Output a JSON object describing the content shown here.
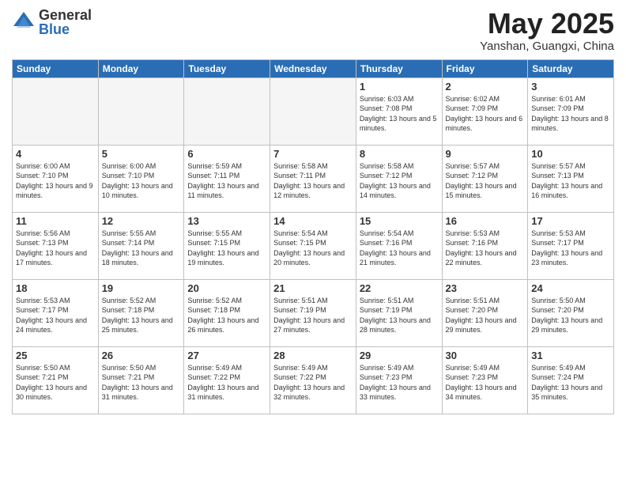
{
  "header": {
    "logo_general": "General",
    "logo_blue": "Blue",
    "month": "May 2025",
    "location": "Yanshan, Guangxi, China"
  },
  "weekdays": [
    "Sunday",
    "Monday",
    "Tuesday",
    "Wednesday",
    "Thursday",
    "Friday",
    "Saturday"
  ],
  "weeks": [
    [
      {
        "day": "",
        "info": ""
      },
      {
        "day": "",
        "info": ""
      },
      {
        "day": "",
        "info": ""
      },
      {
        "day": "",
        "info": ""
      },
      {
        "day": "1",
        "info": "Sunrise: 6:03 AM\nSunset: 7:08 PM\nDaylight: 13 hours\nand 5 minutes."
      },
      {
        "day": "2",
        "info": "Sunrise: 6:02 AM\nSunset: 7:09 PM\nDaylight: 13 hours\nand 6 minutes."
      },
      {
        "day": "3",
        "info": "Sunrise: 6:01 AM\nSunset: 7:09 PM\nDaylight: 13 hours\nand 8 minutes."
      }
    ],
    [
      {
        "day": "4",
        "info": "Sunrise: 6:00 AM\nSunset: 7:10 PM\nDaylight: 13 hours\nand 9 minutes."
      },
      {
        "day": "5",
        "info": "Sunrise: 6:00 AM\nSunset: 7:10 PM\nDaylight: 13 hours\nand 10 minutes."
      },
      {
        "day": "6",
        "info": "Sunrise: 5:59 AM\nSunset: 7:11 PM\nDaylight: 13 hours\nand 11 minutes."
      },
      {
        "day": "7",
        "info": "Sunrise: 5:58 AM\nSunset: 7:11 PM\nDaylight: 13 hours\nand 12 minutes."
      },
      {
        "day": "8",
        "info": "Sunrise: 5:58 AM\nSunset: 7:12 PM\nDaylight: 13 hours\nand 14 minutes."
      },
      {
        "day": "9",
        "info": "Sunrise: 5:57 AM\nSunset: 7:12 PM\nDaylight: 13 hours\nand 15 minutes."
      },
      {
        "day": "10",
        "info": "Sunrise: 5:57 AM\nSunset: 7:13 PM\nDaylight: 13 hours\nand 16 minutes."
      }
    ],
    [
      {
        "day": "11",
        "info": "Sunrise: 5:56 AM\nSunset: 7:13 PM\nDaylight: 13 hours\nand 17 minutes."
      },
      {
        "day": "12",
        "info": "Sunrise: 5:55 AM\nSunset: 7:14 PM\nDaylight: 13 hours\nand 18 minutes."
      },
      {
        "day": "13",
        "info": "Sunrise: 5:55 AM\nSunset: 7:15 PM\nDaylight: 13 hours\nand 19 minutes."
      },
      {
        "day": "14",
        "info": "Sunrise: 5:54 AM\nSunset: 7:15 PM\nDaylight: 13 hours\nand 20 minutes."
      },
      {
        "day": "15",
        "info": "Sunrise: 5:54 AM\nSunset: 7:16 PM\nDaylight: 13 hours\nand 21 minutes."
      },
      {
        "day": "16",
        "info": "Sunrise: 5:53 AM\nSunset: 7:16 PM\nDaylight: 13 hours\nand 22 minutes."
      },
      {
        "day": "17",
        "info": "Sunrise: 5:53 AM\nSunset: 7:17 PM\nDaylight: 13 hours\nand 23 minutes."
      }
    ],
    [
      {
        "day": "18",
        "info": "Sunrise: 5:53 AM\nSunset: 7:17 PM\nDaylight: 13 hours\nand 24 minutes."
      },
      {
        "day": "19",
        "info": "Sunrise: 5:52 AM\nSunset: 7:18 PM\nDaylight: 13 hours\nand 25 minutes."
      },
      {
        "day": "20",
        "info": "Sunrise: 5:52 AM\nSunset: 7:18 PM\nDaylight: 13 hours\nand 26 minutes."
      },
      {
        "day": "21",
        "info": "Sunrise: 5:51 AM\nSunset: 7:19 PM\nDaylight: 13 hours\nand 27 minutes."
      },
      {
        "day": "22",
        "info": "Sunrise: 5:51 AM\nSunset: 7:19 PM\nDaylight: 13 hours\nand 28 minutes."
      },
      {
        "day": "23",
        "info": "Sunrise: 5:51 AM\nSunset: 7:20 PM\nDaylight: 13 hours\nand 29 minutes."
      },
      {
        "day": "24",
        "info": "Sunrise: 5:50 AM\nSunset: 7:20 PM\nDaylight: 13 hours\nand 29 minutes."
      }
    ],
    [
      {
        "day": "25",
        "info": "Sunrise: 5:50 AM\nSunset: 7:21 PM\nDaylight: 13 hours\nand 30 minutes."
      },
      {
        "day": "26",
        "info": "Sunrise: 5:50 AM\nSunset: 7:21 PM\nDaylight: 13 hours\nand 31 minutes."
      },
      {
        "day": "27",
        "info": "Sunrise: 5:49 AM\nSunset: 7:22 PM\nDaylight: 13 hours\nand 31 minutes."
      },
      {
        "day": "28",
        "info": "Sunrise: 5:49 AM\nSunset: 7:22 PM\nDaylight: 13 hours\nand 32 minutes."
      },
      {
        "day": "29",
        "info": "Sunrise: 5:49 AM\nSunset: 7:23 PM\nDaylight: 13 hours\nand 33 minutes."
      },
      {
        "day": "30",
        "info": "Sunrise: 5:49 AM\nSunset: 7:23 PM\nDaylight: 13 hours\nand 34 minutes."
      },
      {
        "day": "31",
        "info": "Sunrise: 5:49 AM\nSunset: 7:24 PM\nDaylight: 13 hours\nand 35 minutes."
      }
    ]
  ]
}
